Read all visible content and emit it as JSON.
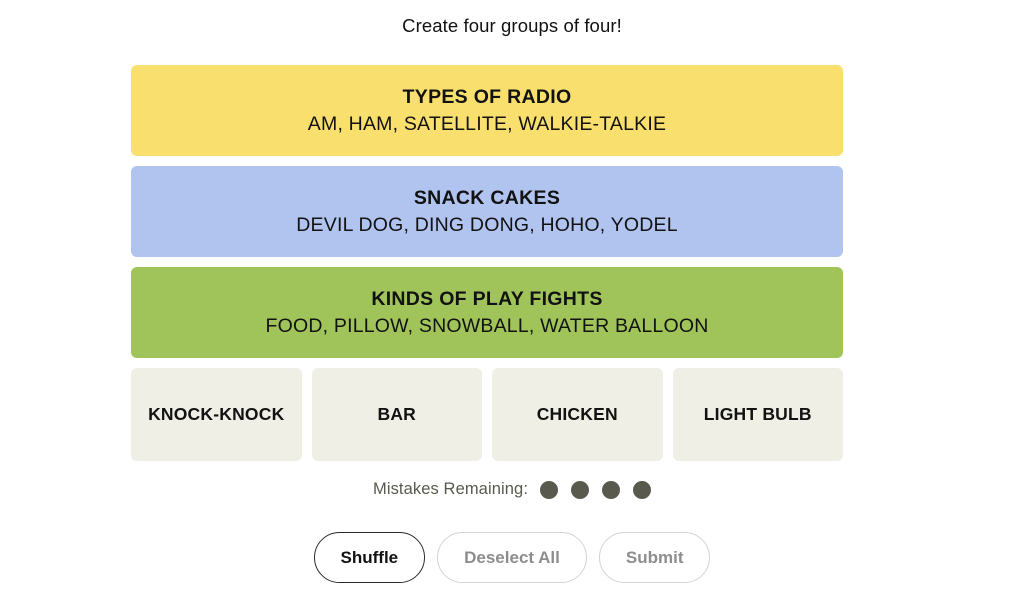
{
  "header": {
    "instruction": "Create four groups of four!"
  },
  "board": {
    "solved_groups": [
      {
        "category": "TYPES OF RADIO",
        "members": "AM, HAM, SATELLITE, WALKIE-TALKIE",
        "color": "#f9df6d",
        "difficulty": "yellow"
      },
      {
        "category": "SNACK CAKES",
        "members": "DEVIL DOG, DING DONG, HOHO, YODEL",
        "color": "#b0c4ef",
        "difficulty": "blue"
      },
      {
        "category": "KINDS OF PLAY FIGHTS",
        "members": "FOOD, PILLOW, SNOWBALL, WATER BALLOON",
        "color": "#a0c35a",
        "difficulty": "green"
      }
    ],
    "remaining_tiles": [
      {
        "label": "KNOCK-KNOCK"
      },
      {
        "label": "BAR"
      },
      {
        "label": "CHICKEN"
      },
      {
        "label": "LIGHT BULB"
      }
    ],
    "tile_color": "#efefe6"
  },
  "mistakes": {
    "label": "Mistakes Remaining:",
    "remaining": 4,
    "dot_color": "#5a594e"
  },
  "controls": {
    "buttons": [
      {
        "label": "Shuffle",
        "state": "enabled"
      },
      {
        "label": "Deselect All",
        "state": "disabled"
      },
      {
        "label": "Submit",
        "state": "disabled"
      }
    ]
  }
}
